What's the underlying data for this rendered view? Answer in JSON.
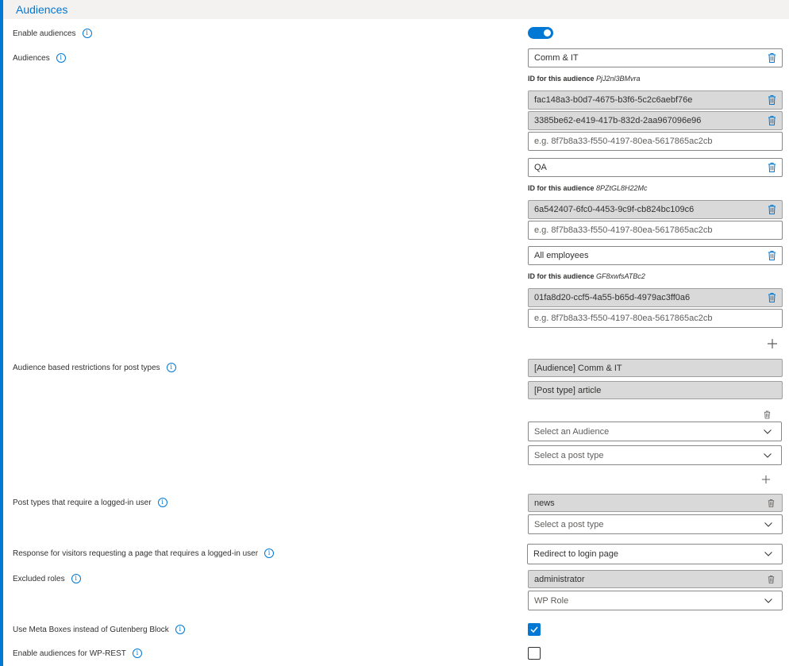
{
  "section": {
    "title": "Audiences"
  },
  "labels": {
    "enable_audiences": "Enable audiences",
    "audiences": "Audiences",
    "restrictions": "Audience based restrictions for post types",
    "post_types_login": "Post types that require a logged-in user",
    "response_visitors": "Response for visitors requesting a page that requires a logged-in user",
    "excluded_roles": "Excluded roles",
    "use_meta_boxes": "Use Meta Boxes instead of Gutenberg Block",
    "enable_wp_rest": "Enable audiences for WP-REST"
  },
  "info_glyph": "i",
  "enable_audiences": {
    "on": true
  },
  "audiences": [
    {
      "name": "Comm & IT",
      "id_label": "ID for this audience",
      "id_value": "PjJ2nl3BMvra",
      "groups": [
        "fac148a3-b0d7-4675-b3f6-5c2c6aebf76e",
        "3385be62-e419-417b-832d-2aa967096e96"
      ],
      "placeholder": "e.g. 8f7b8a33-f550-4197-80ea-5617865ac2cb"
    },
    {
      "name": "QA",
      "id_label": "ID for this audience",
      "id_value": "8PZtGL8H22Mc",
      "groups": [
        "6a542407-6fc0-4453-9c9f-cb824bc109c6"
      ],
      "placeholder": "e.g. 8f7b8a33-f550-4197-80ea-5617865ac2cb"
    },
    {
      "name": "All employees",
      "id_label": "ID for this audience",
      "id_value": "GF8xwfsATBc2",
      "groups": [
        "01fa8d20-ccf5-4a55-b65d-4979ac3ff0a6"
      ],
      "placeholder": "e.g. 8f7b8a33-f550-4197-80ea-5617865ac2cb"
    }
  ],
  "restrictions": {
    "items": [
      "[Audience] Comm & IT",
      "[Post type] article"
    ],
    "select_audience": "Select an Audience",
    "select_post_type": "Select a post type"
  },
  "post_types_login": {
    "items": [
      "news"
    ],
    "select_post_type": "Select a post type"
  },
  "response_visitors": {
    "value": "Redirect to login page"
  },
  "excluded_roles": {
    "items": [
      "administrator"
    ],
    "select_role": "WP Role"
  },
  "use_meta_boxes": {
    "checked": true
  },
  "enable_wp_rest": {
    "checked": false
  },
  "colors": {
    "accent": "#0078d4",
    "readonly_bg": "#d9d9d9",
    "header_bg": "#f3f2f1"
  },
  "icons": [
    "info-icon",
    "trash-icon",
    "plus-icon",
    "chevron-down-icon",
    "checkmark-icon"
  ]
}
